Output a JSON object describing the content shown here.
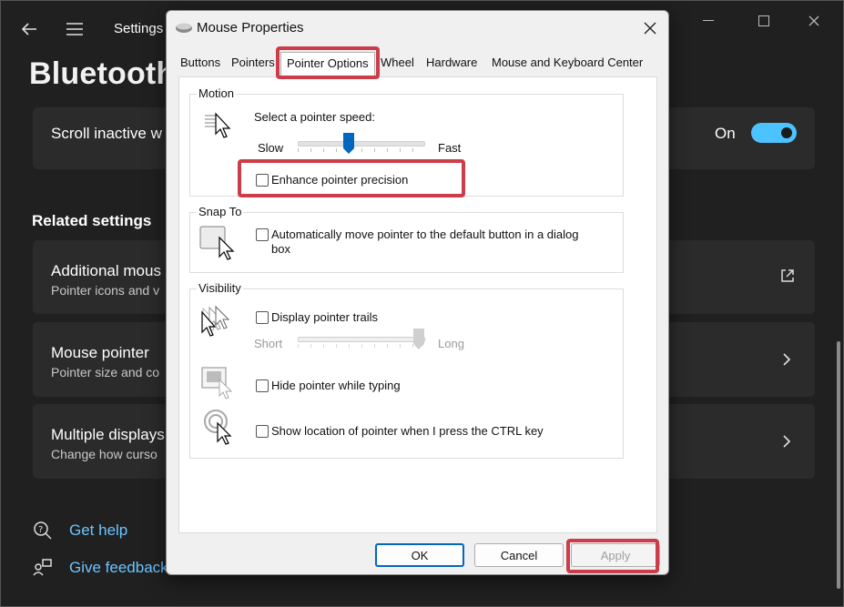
{
  "settings": {
    "window_title": "Settings",
    "page_title": "Bluetooth",
    "scroll_inactive": {
      "title": "Scroll inactive w",
      "state": "On"
    },
    "related_settings_header": "Related settings",
    "cards": [
      {
        "title": "Additional mous",
        "subtitle": "Pointer icons and v"
      },
      {
        "title": "Mouse pointer",
        "subtitle": "Pointer size and co"
      },
      {
        "title": "Multiple displays",
        "subtitle": "Change how curso"
      }
    ],
    "get_help": "Get help",
    "give_feedback": "Give feedback"
  },
  "dialog": {
    "title": "Mouse Properties",
    "tabs": [
      "Buttons",
      "Pointers",
      "Pointer Options",
      "Wheel",
      "Hardware",
      "Mouse and Keyboard Center"
    ],
    "active_tab": "Pointer Options",
    "motion": {
      "label": "Motion",
      "speed_label": "Select a pointer speed:",
      "slow": "Slow",
      "fast": "Fast",
      "speed_level": 0.42,
      "enhance_precision": "Enhance pointer precision"
    },
    "snap_to": {
      "label": "Snap To",
      "option_line1": "Automatically move pointer to the default button in a dialog",
      "option_line2": "box"
    },
    "visibility": {
      "label": "Visibility",
      "trails": "Display pointer trails",
      "short": "Short",
      "long": "Long",
      "trail_level": 0.95,
      "hide_typing": "Hide pointer while typing",
      "show_location": "Show location of pointer when I press the CTRL key"
    },
    "buttons": {
      "ok": "OK",
      "cancel": "Cancel",
      "apply": "Apply"
    }
  },
  "colors": {
    "accent": "#0067c0",
    "toggle": "#4cc2ff",
    "highlight": "#cc3d4a",
    "link": "#6cc4ff"
  }
}
